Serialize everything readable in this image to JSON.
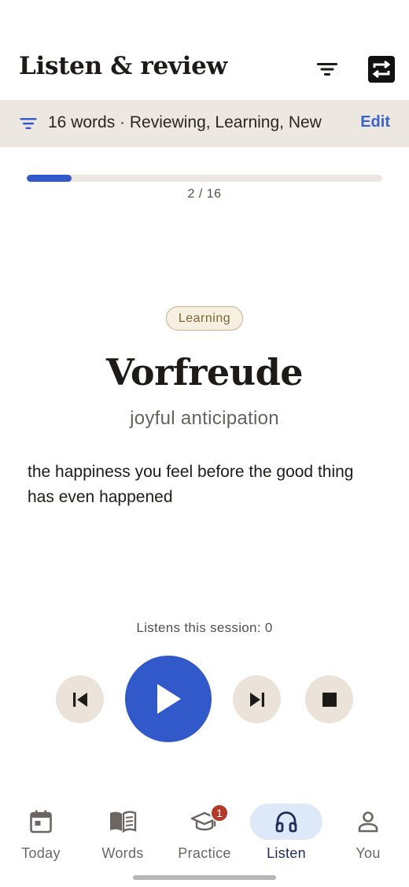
{
  "header": {
    "title": "Listen & review",
    "filter_icon": "filter-lines-icon",
    "swap_icon": "swap-arrows-icon"
  },
  "filter_bar": {
    "icon": "filter-lines-icon",
    "summary": "16 words · Reviewing, Learning, New",
    "edit_label": "Edit"
  },
  "progress": {
    "current": 2,
    "total": 16,
    "label": "2 / 16"
  },
  "card": {
    "status_badge": "Learning",
    "word": "Vorfreude",
    "translation": "joyful anticipation",
    "definition": "the happiness you feel before the good thing has even happened"
  },
  "session": {
    "listens_label": "Listens this session: 0"
  },
  "controls": {
    "previous_icon": "skip-previous-icon",
    "play_icon": "play-icon",
    "next_icon": "skip-next-icon",
    "stop_icon": "stop-icon"
  },
  "nav": {
    "items": [
      {
        "label": "Today",
        "icon": "calendar-icon"
      },
      {
        "label": "Words",
        "icon": "book-icon"
      },
      {
        "label": "Practice",
        "icon": "graduation-cap-icon",
        "badge": "1"
      },
      {
        "label": "Listen",
        "icon": "headphones-icon",
        "active": true
      },
      {
        "label": "You",
        "icon": "person-icon"
      }
    ]
  },
  "colors": {
    "accent": "#3159c9",
    "filter_bar_bg": "#ece7e0",
    "badge_border": "#c8b48c",
    "nav_active_bg": "#dde8f8",
    "notification": "#b33a2a"
  }
}
